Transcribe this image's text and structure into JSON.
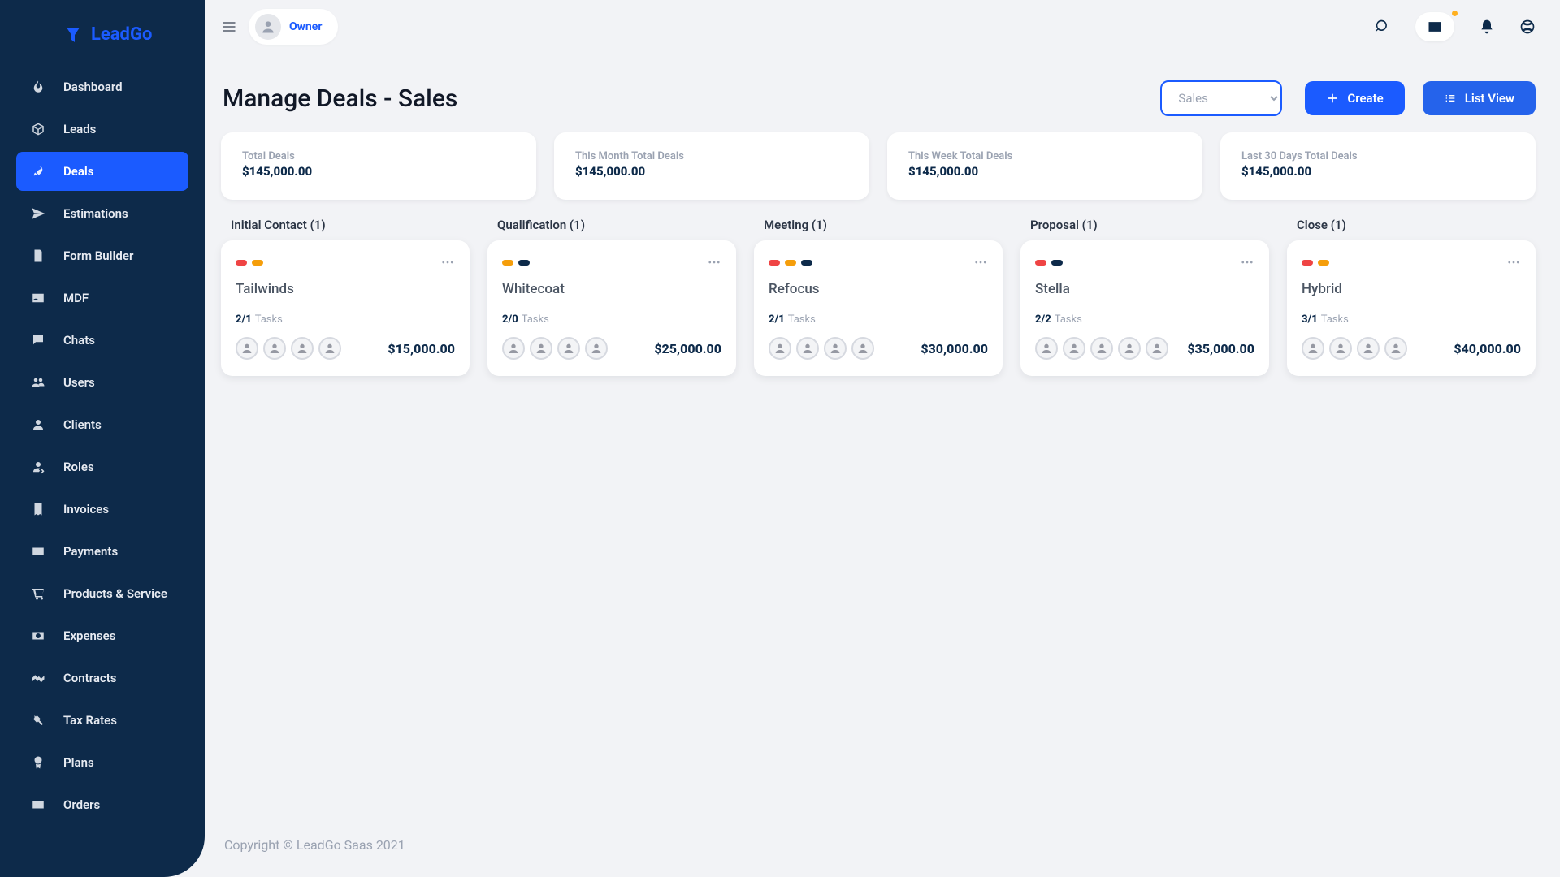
{
  "brand": "LeadGo",
  "owner_role": "Owner",
  "sidebar": {
    "items": [
      {
        "label": "Dashboard",
        "icon": "fire"
      },
      {
        "label": "Leads",
        "icon": "cube"
      },
      {
        "label": "Deals",
        "icon": "rocket",
        "active": true
      },
      {
        "label": "Estimations",
        "icon": "send"
      },
      {
        "label": "Form Builder",
        "icon": "form"
      },
      {
        "label": "MDF",
        "icon": "id-card"
      },
      {
        "label": "Chats",
        "icon": "chat"
      },
      {
        "label": "Users",
        "icon": "users"
      },
      {
        "label": "Clients",
        "icon": "client"
      },
      {
        "label": "Roles",
        "icon": "roles"
      },
      {
        "label": "Invoices",
        "icon": "invoice"
      },
      {
        "label": "Payments",
        "icon": "card"
      },
      {
        "label": "Products & Service",
        "icon": "cart"
      },
      {
        "label": "Expenses",
        "icon": "money"
      },
      {
        "label": "Contracts",
        "icon": "handshake"
      },
      {
        "label": "Tax Rates",
        "icon": "tools"
      },
      {
        "label": "Plans",
        "icon": "award"
      },
      {
        "label": "Orders",
        "icon": "card"
      }
    ]
  },
  "page_title": "Manage Deals - Sales",
  "pipeline_selected": "Sales",
  "buttons": {
    "create": "Create",
    "list_view": "List View"
  },
  "stats": [
    {
      "label": "Total Deals",
      "value": "$145,000.00"
    },
    {
      "label": "This Month Total Deals",
      "value": "$145,000.00"
    },
    {
      "label": "This Week Total Deals",
      "value": "$145,000.00"
    },
    {
      "label": "Last 30 Days Total Deals",
      "value": "$145,000.00"
    }
  ],
  "tasks_label": "Tasks",
  "columns": [
    {
      "title": "Initial Contact (1)",
      "card": {
        "name": "Tailwinds",
        "pill_colors": [
          "#ef4444",
          "#f59e0b"
        ],
        "tasks": "2/1",
        "avatars": 4,
        "amount": "$15,000.00"
      }
    },
    {
      "title": "Qualification (1)",
      "card": {
        "name": "Whitecoat",
        "pill_colors": [
          "#f59e0b",
          "#0d2a4a"
        ],
        "tasks": "2/0",
        "avatars": 4,
        "amount": "$25,000.00"
      }
    },
    {
      "title": "Meeting (1)",
      "card": {
        "name": "Refocus",
        "pill_colors": [
          "#ef4444",
          "#f59e0b",
          "#0d2a4a"
        ],
        "tasks": "2/1",
        "avatars": 4,
        "amount": "$30,000.00"
      }
    },
    {
      "title": "Proposal (1)",
      "card": {
        "name": "Stella",
        "pill_colors": [
          "#ef4444",
          "#0d2a4a"
        ],
        "tasks": "2/2",
        "avatars": 5,
        "amount": "$35,000.00"
      }
    },
    {
      "title": "Close (1)",
      "card": {
        "name": "Hybrid",
        "pill_colors": [
          "#ef4444",
          "#f59e0b"
        ],
        "tasks": "3/1",
        "avatars": 4,
        "amount": "$40,000.00"
      }
    }
  ],
  "footer": "Copyright © LeadGo Saas 2021"
}
